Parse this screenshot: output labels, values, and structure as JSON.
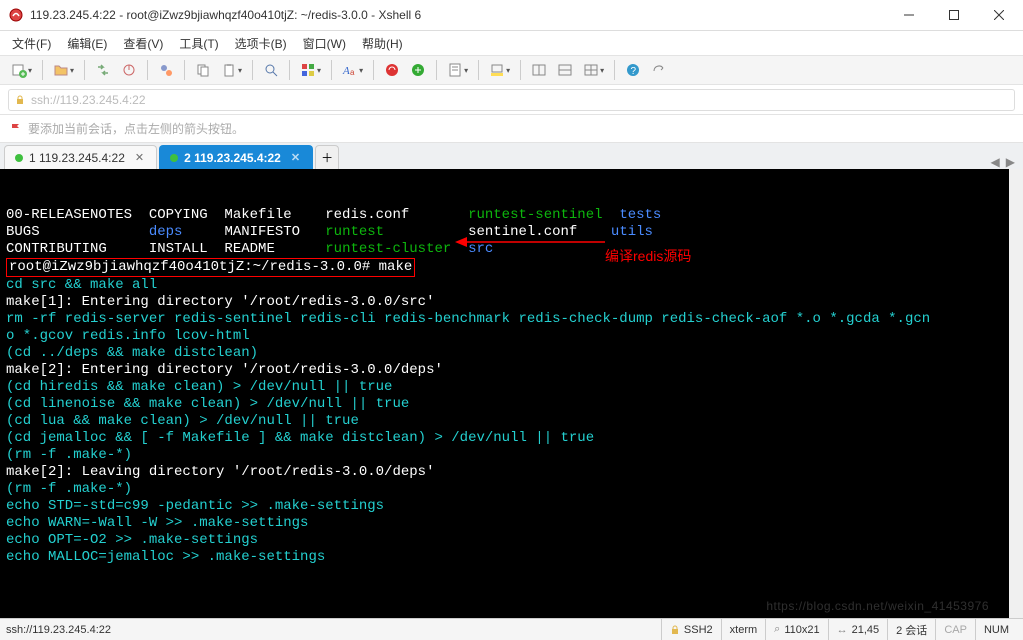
{
  "window": {
    "title": "119.23.245.4:22 - root@iZwz9bjiawhqzf40o410tjZ: ~/redis-3.0.0 - Xshell 6"
  },
  "menu": {
    "file": "文件(F)",
    "edit": "编辑(E)",
    "view": "查看(V)",
    "tools": "工具(T)",
    "tabs": "选项卡(B)",
    "window": "窗口(W)",
    "help": "帮助(H)"
  },
  "address": {
    "placeholder": "ssh://119.23.245.4:22"
  },
  "hint": "要添加当前会话，点击左侧的箭头按钮。",
  "tabs": {
    "t1": "1 119.23.245.4:22",
    "t2": "2 119.23.245.4:22"
  },
  "term": {
    "l1a": "00-RELEASENOTES  COPYING  Makefile    redis.conf       ",
    "l1b": "runtest-sentinel",
    "l1c": "  ",
    "l1d": "tests",
    "l2a": "BUGS             ",
    "l2b": "deps",
    "l2c": "     MANIFESTO   ",
    "l2d": "runtest",
    "l2e": "          sentinel.conf    ",
    "l2f": "utils",
    "l3a": "CONTRIBUTING     INSTALL  README      ",
    "l3b": "runtest-cluster",
    "l3c": "  ",
    "l3d": "src",
    "l4a": "root@iZwz9bjiawhqzf40o410tjZ:~/redis-3.0.0# make",
    "l5": "cd src && make all",
    "l6": "make[1]: Entering directory '/root/redis-3.0.0/src'",
    "l7": "rm -rf redis-server redis-sentinel redis-cli redis-benchmark redis-check-dump redis-check-aof *.o *.gcda *.gcn",
    "l8": "o *.gcov redis.info lcov-html",
    "l9": "(cd ../deps && make distclean)",
    "l10": "make[2]: Entering directory '/root/redis-3.0.0/deps'",
    "l11": "(cd hiredis && make clean) > /dev/null || true",
    "l12": "(cd linenoise && make clean) > /dev/null || true",
    "l13": "(cd lua && make clean) > /dev/null || true",
    "l14": "(cd jemalloc && [ -f Makefile ] && make distclean) > /dev/null || true",
    "l15": "(rm -f .make-*)",
    "l16": "make[2]: Leaving directory '/root/redis-3.0.0/deps'",
    "l17": "(rm -f .make-*)",
    "l18": "echo STD=-std=c99 -pedantic >> .make-settings",
    "l19": "echo WARN=-Wall -W >> .make-settings",
    "l20": "echo OPT=-O2 >> .make-settings",
    "l21": "echo MALLOC=jemalloc >> .make-settings"
  },
  "annotation": "编译redis源码",
  "status": {
    "ssh": "ssh://119.23.245.4:22",
    "proto": "SSH2",
    "term": "xterm",
    "size": "110x21",
    "pos": "21,45",
    "sess": "2 会话",
    "cap": "CAP",
    "num": "NUM"
  },
  "watermark": "https://blog.csdn.net/weixin_41453976"
}
